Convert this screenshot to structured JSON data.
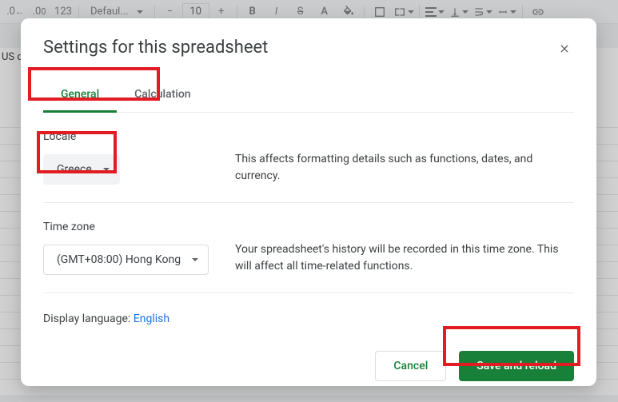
{
  "toolbar": {
    "font_name": "Defaul...",
    "font_size": "10",
    "format_123": "123"
  },
  "bg_cell": "US d",
  "dialog": {
    "title": "Settings for this spreadsheet",
    "tabs": {
      "general": "General",
      "calculation": "Calculation"
    },
    "locale": {
      "label": "Locale",
      "value": "Greece",
      "desc": "This affects formatting details such as functions, dates, and currency."
    },
    "timezone": {
      "label": "Time zone",
      "value": "(GMT+08:00) Hong Kong",
      "desc": "Your spreadsheet's history will be recorded in this time zone. This will affect all time-related functions."
    },
    "display_lang": {
      "label": "Display language: ",
      "link": "English"
    },
    "buttons": {
      "cancel": "Cancel",
      "save": "Save and reload"
    }
  }
}
